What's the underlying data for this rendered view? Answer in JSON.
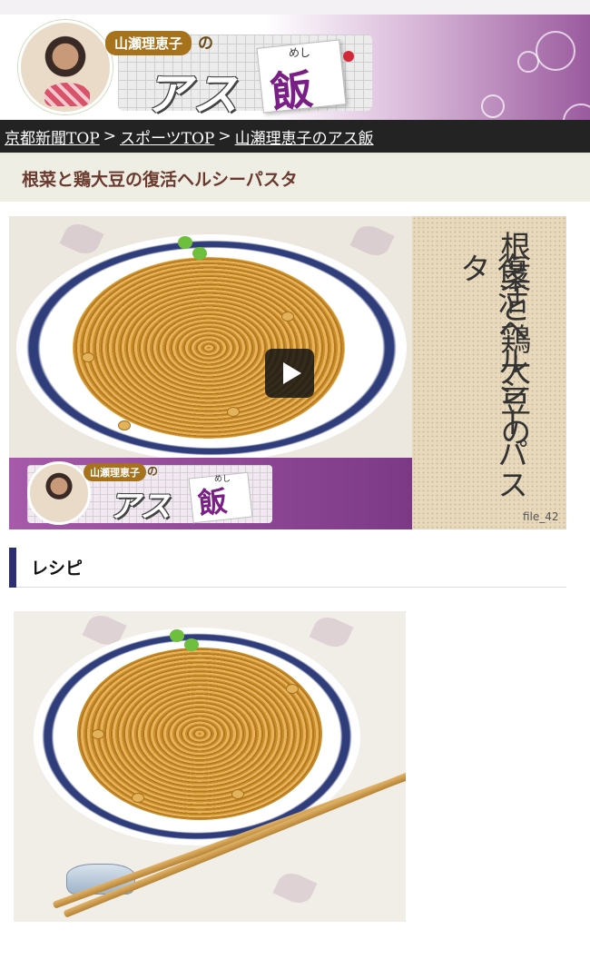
{
  "banner": {
    "subtitle": "山瀬理恵子",
    "subtitle_particle": "の",
    "brand_main": "アス",
    "brand_kanji": "飯",
    "brand_ruby": "めし"
  },
  "breadcrumb": {
    "items": [
      "京都新聞TOP",
      "スポーツTOP",
      "山瀬理恵子のアス飯"
    ],
    "separator": ">"
  },
  "article": {
    "title": "根菜と鶏大豆の復活ヘルシーパスタ"
  },
  "video": {
    "vertical_title_line1": "根菜と鶏大豆の",
    "vertical_title_line2": "復活ヘルシーパスタ",
    "file_label": "file_42",
    "band_subtitle": "山瀬理恵子",
    "band_particle": "の",
    "band_brand": "アス",
    "band_kanji": "飯",
    "band_ruby": "めし",
    "play_icon": "play-icon"
  },
  "recipe": {
    "heading": "レシピ"
  },
  "colors": {
    "breadcrumb_bg": "#232323",
    "title_bar_bg": "#efeee4",
    "title_text": "#6b3a2e",
    "section_accent": "#2e2f6e",
    "brand_purple": "#7a1f85"
  }
}
